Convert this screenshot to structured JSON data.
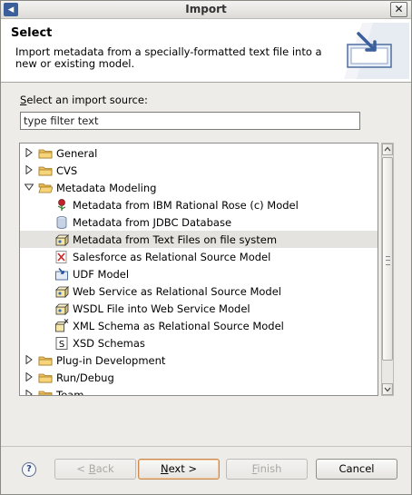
{
  "window": {
    "title": "Import",
    "close_glyph": "✕"
  },
  "header": {
    "title": "Select",
    "description": "Import metadata from a specially-formatted text file into a new or existing model."
  },
  "source": {
    "label_mnemonic": "S",
    "label_rest": "elect an import source:",
    "filter_value": "type filter text"
  },
  "tree": {
    "items": [
      {
        "label": "General",
        "level": 0,
        "expander": "collapsed",
        "icon": "folder-icon"
      },
      {
        "label": "CVS",
        "level": 0,
        "expander": "collapsed",
        "icon": "folder-icon"
      },
      {
        "label": "Metadata Modeling",
        "level": 0,
        "expander": "expanded",
        "icon": "folder-open-icon"
      },
      {
        "label": "Metadata from IBM Rational Rose (c) Model",
        "level": 1,
        "icon": "rose-icon"
      },
      {
        "label": "Metadata from JDBC Database",
        "level": 1,
        "icon": "database-icon"
      },
      {
        "label": "Metadata from Text Files on file system",
        "level": 1,
        "icon": "package-icon",
        "selected": true
      },
      {
        "label": "Salesforce as Relational Source Model",
        "level": 1,
        "icon": "salesforce-icon"
      },
      {
        "label": "UDF Model",
        "level": 1,
        "icon": "udf-icon"
      },
      {
        "label": "Web Service as Relational Source Model",
        "level": 1,
        "icon": "package-icon"
      },
      {
        "label": "WSDL File into Web Service Model",
        "level": 1,
        "icon": "package-icon"
      },
      {
        "label": "XML Schema as Relational Source Model",
        "level": 1,
        "icon": "xml-schema-icon"
      },
      {
        "label": "XSD Schemas",
        "level": 1,
        "icon": "xsd-icon"
      },
      {
        "label": "Plug-in Development",
        "level": 0,
        "expander": "collapsed",
        "icon": "folder-icon"
      },
      {
        "label": "Run/Debug",
        "level": 0,
        "expander": "collapsed",
        "icon": "folder-icon"
      },
      {
        "label": "Team",
        "level": 0,
        "expander": "collapsed",
        "icon": "folder-icon"
      }
    ]
  },
  "buttons": {
    "help": "?",
    "back": "< Back",
    "back_mnemonic": "B",
    "next": "Next >",
    "next_mnemonic": "N",
    "finish": "Finish",
    "finish_mnemonic": "F",
    "cancel": "Cancel"
  },
  "colors": {
    "selection": "#e4e3df",
    "default_button_border": "#c88a50",
    "folder": "#f0c060"
  }
}
